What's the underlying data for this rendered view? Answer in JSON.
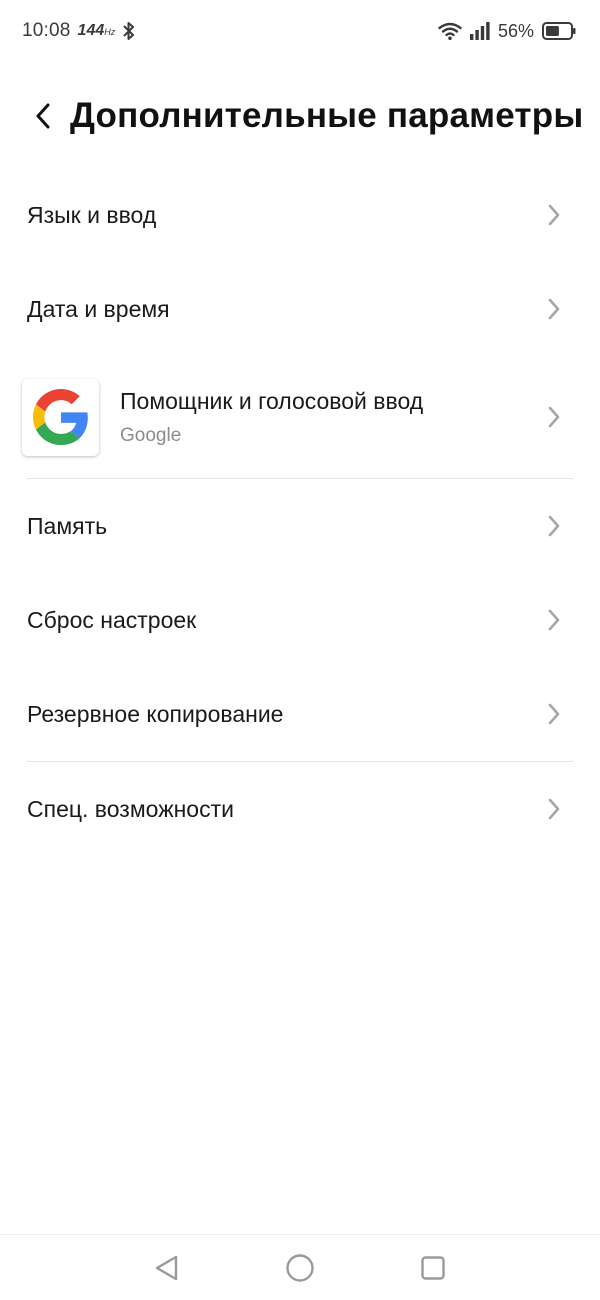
{
  "status_bar": {
    "time": "10:08",
    "refresh_rate": "144",
    "refresh_unit": "Hz",
    "battery_percent": "56%",
    "battery_level": 0.56,
    "icons": [
      "bluetooth-icon",
      "wifi-icon",
      "signal-icon",
      "battery-icon"
    ]
  },
  "header": {
    "title": "Дополнительные параметры",
    "back_icon": "chevron-left-icon"
  },
  "list": {
    "items": [
      {
        "label": "Язык и ввод"
      },
      {
        "label": "Дата и время"
      },
      {
        "label": "Помощник и голосовой ввод",
        "sublabel": "Google",
        "icon": "google-icon"
      },
      {
        "label": "Память"
      },
      {
        "label": "Сброс настроек"
      },
      {
        "label": "Резервное копирование"
      },
      {
        "label": "Спец. возможности"
      }
    ]
  },
  "nav_bar": {
    "icons": [
      "back-triangle-icon",
      "home-circle-icon",
      "recents-square-icon"
    ]
  },
  "colors": {
    "text": "#1a1a1a",
    "secondary_text": "#8c8c8c",
    "chevron": "#a6a6a6",
    "divider": "#e2e2e2",
    "google_blue": "#4285F4",
    "google_red": "#EA4335",
    "google_yellow": "#FBBC05",
    "google_green": "#34A853"
  }
}
